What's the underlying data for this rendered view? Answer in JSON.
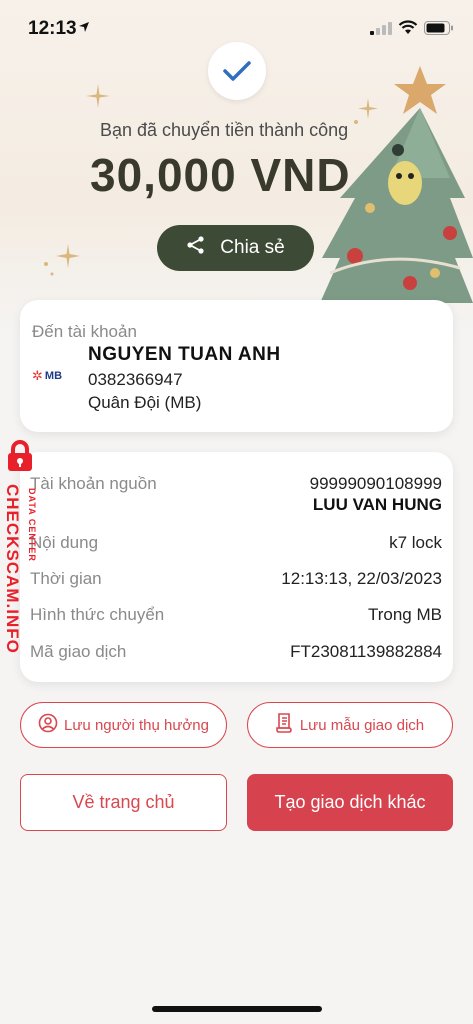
{
  "status_bar": {
    "time": "12:13"
  },
  "header": {
    "success_message": "Bạn đã chuyển tiền thành công",
    "amount": "30,000 VND",
    "share_label": "Chia sẻ"
  },
  "recipient": {
    "to_label": "Đến tài khoản",
    "bank_logo_text": "MB",
    "name": "NGUYEN TUAN ANH",
    "account": "0382366947",
    "bank": "Quân Đội (MB)"
  },
  "details": {
    "source_label": "Tài khoản nguồn",
    "source_account": "99999090108999",
    "source_name": "LUU VAN HUNG",
    "content_label": "Nội dung",
    "content_value": "k7 lock",
    "time_label": "Thời gian",
    "time_value": "12:13:13, 22/03/2023",
    "method_label": "Hình thức chuyển",
    "method_value": "Trong MB",
    "tx_code_label": "Mã giao dịch",
    "tx_code_value": "FT23081139882884"
  },
  "watermark": {
    "main": "CHECKSCAM.INFO",
    "sub": "DATA CENTER"
  },
  "actions": {
    "save_payee": "Lưu người thụ hưởng",
    "save_template": "Lưu mẫu giao dịch",
    "home": "Về trang chủ",
    "new_transaction": "Tạo giao dịch khác"
  },
  "colors": {
    "accent": "#d6434e",
    "share_bg": "#3d4a36",
    "amount": "#3a3a2c"
  }
}
